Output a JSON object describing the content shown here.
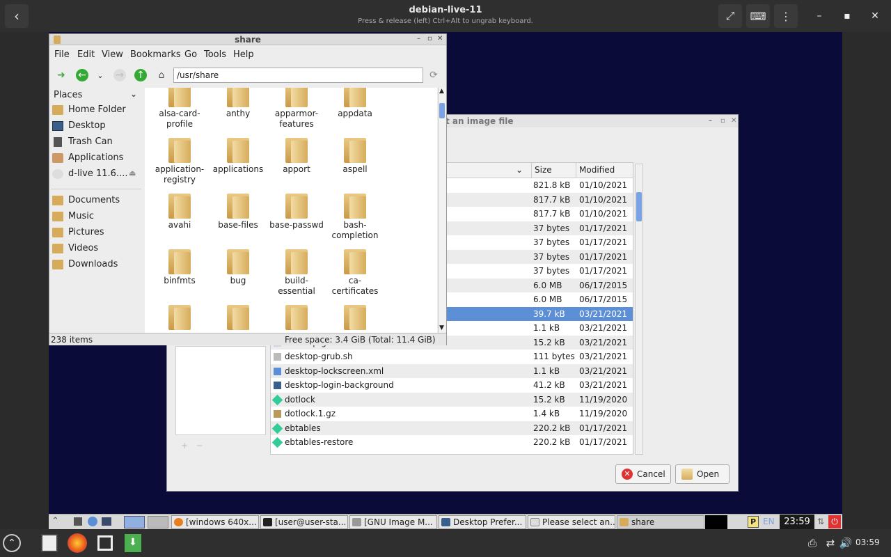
{
  "viewer": {
    "title": "debian-live-11",
    "subtitle": "Press & release (left) Ctrl+Alt to ungrab keyboard."
  },
  "file_manager": {
    "title": "share",
    "menu": [
      "File",
      "Edit",
      "View",
      "Bookmarks",
      "Go",
      "Tools",
      "Help"
    ],
    "path": "/usr/share",
    "places_header": "Places",
    "places": [
      "Home Folder",
      "Desktop",
      "Trash Can",
      "Applications",
      "d-live 11.6...."
    ],
    "bookmarks": [
      "Documents",
      "Music",
      "Pictures",
      "Videos",
      "Downloads"
    ],
    "icons": [
      "alsa-card-profile",
      "anthy",
      "apparmor-features",
      "appdata",
      "application-registry",
      "applications",
      "apport",
      "aspell",
      "avahi",
      "base-files",
      "base-passwd",
      "bash-completion",
      "binfmts",
      "bug",
      "build-essential",
      "ca-certificates"
    ],
    "status_items": "238 items",
    "status_space": "Free space: 3.4 GiB (Total: 11.4 GiB)"
  },
  "dialog": {
    "title": "t an image file",
    "columns": {
      "size": "Size",
      "modified": "Modified"
    },
    "rows": [
      {
        "name": "",
        "size": "821.8 kB",
        "modified": "01/10/2021",
        "icon": "file"
      },
      {
        "name": "",
        "size": "817.7 kB",
        "modified": "01/10/2021",
        "icon": "file"
      },
      {
        "name": "",
        "size": "817.7 kB",
        "modified": "01/10/2021",
        "icon": "file"
      },
      {
        "name": "",
        "size": "37 bytes",
        "modified": "01/17/2021",
        "icon": "file"
      },
      {
        "name": "",
        "size": "37 bytes",
        "modified": "01/17/2021",
        "icon": "file"
      },
      {
        "name": "",
        "size": "37 bytes",
        "modified": "01/17/2021",
        "icon": "file"
      },
      {
        "name": "",
        "size": "37 bytes",
        "modified": "01/17/2021",
        "icon": "file"
      },
      {
        "name": "",
        "size": "6.0 MB",
        "modified": "06/17/2015",
        "icon": "file"
      },
      {
        "name": "",
        "size": "6.0 MB",
        "modified": "06/17/2015",
        "icon": "file"
      },
      {
        "name": "",
        "size": "39.7 kB",
        "modified": "03/21/2021",
        "icon": "file",
        "selected": true
      },
      {
        "name": "",
        "size": "1.1 kB",
        "modified": "03/21/2021",
        "icon": "file"
      },
      {
        "name": "desktop-grub",
        "size": "15.2 kB",
        "modified": "03/21/2021",
        "icon": "file"
      },
      {
        "name": "desktop-grub.sh",
        "size": "111 bytes",
        "modified": "03/21/2021",
        "icon": "script"
      },
      {
        "name": "desktop-lockscreen.xml",
        "size": "1.1 kB",
        "modified": "03/21/2021",
        "icon": "xml"
      },
      {
        "name": "desktop-login-background",
        "size": "41.2 kB",
        "modified": "03/21/2021",
        "icon": "image"
      },
      {
        "name": "dotlock",
        "size": "15.2 kB",
        "modified": "11/19/2020",
        "icon": "exec"
      },
      {
        "name": "dotlock.1.gz",
        "size": "1.4 kB",
        "modified": "11/19/2020",
        "icon": "archive"
      },
      {
        "name": "ebtables",
        "size": "220.2 kB",
        "modified": "01/17/2021",
        "icon": "exec"
      },
      {
        "name": "ebtables-restore",
        "size": "220.2 kB",
        "modified": "01/17/2021",
        "icon": "exec"
      }
    ],
    "cancel_label": "Cancel",
    "open_label": "Open"
  },
  "taskbar": {
    "tasks": [
      "[windows 640x...",
      "[user@user-sta...",
      "[GNU Image M...",
      "Desktop Prefer...",
      "Please select an...",
      "share"
    ],
    "lang": "EN",
    "clock": "23:59"
  },
  "host": {
    "time": "03:59"
  },
  "colors": {
    "selection": "#5c8fd6",
    "vm_background": "#0b0b3a",
    "folder": "#d6ac5c"
  }
}
